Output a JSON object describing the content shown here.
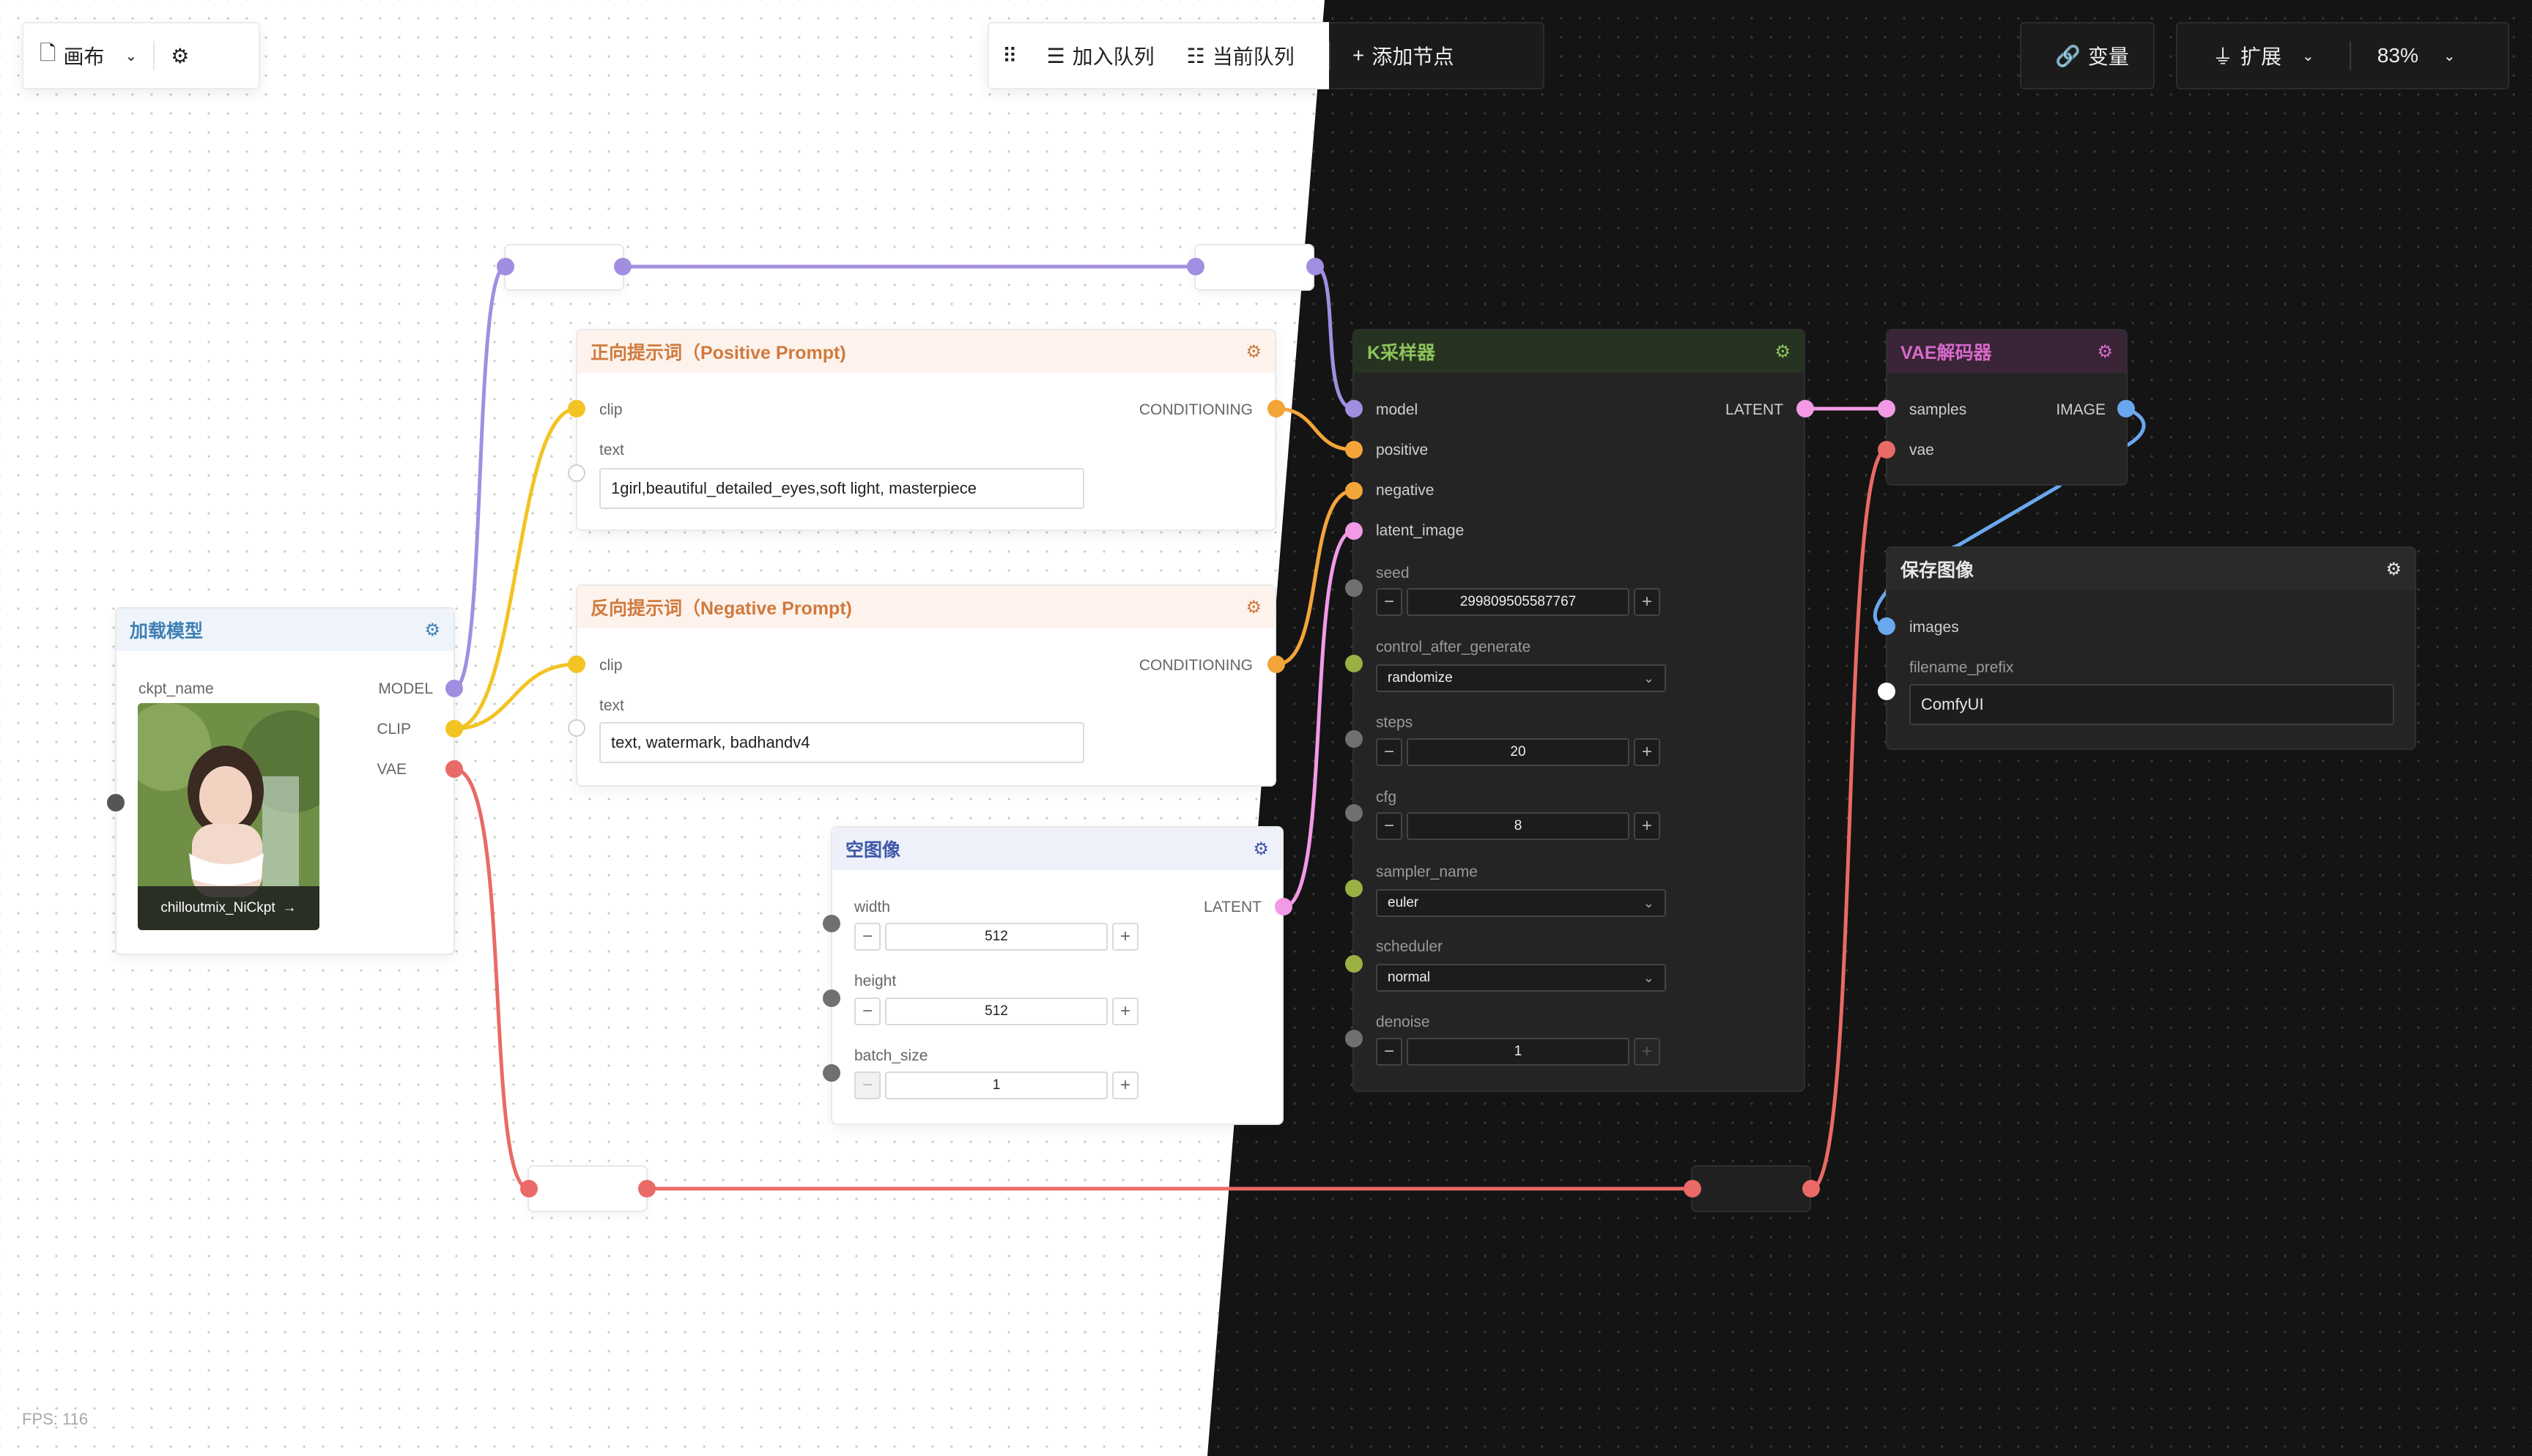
{
  "toolbar": {
    "canvas_label": "画布",
    "queue_label": "加入队列",
    "current_queue_label": "当前队列",
    "add_node_label": "添加节点",
    "variables_label": "变量",
    "extensions_label": "扩展",
    "zoom": "83%"
  },
  "nodes": {
    "load_model": {
      "title": "加载模型",
      "ckpt_label": "ckpt_name",
      "out_model": "MODEL",
      "out_clip": "CLIP",
      "out_vae": "VAE",
      "ckpt_value": "chilloutmix_NiCkpt"
    },
    "positive": {
      "title": "正向提示词（Positive Prompt)",
      "in_clip": "clip",
      "text_label": "text",
      "out": "CONDITIONING",
      "text": "1girl,beautiful_detailed_eyes,soft light, masterpiece"
    },
    "negative": {
      "title": "反向提示词（Negative Prompt)",
      "in_clip": "clip",
      "text_label": "text",
      "out": "CONDITIONING",
      "text": "text, watermark, badhandv4"
    },
    "empty_latent": {
      "title": "空图像",
      "width_label": "width",
      "width": "512",
      "height_label": "height",
      "height": "512",
      "batch_label": "batch_size",
      "batch": "1",
      "out": "LATENT"
    },
    "ksampler": {
      "title": "K采样器",
      "in_model": "model",
      "in_positive": "positive",
      "in_negative": "negative",
      "in_latent": "latent_image",
      "out": "LATENT",
      "seed_label": "seed",
      "seed": "299809505587767",
      "control_label": "control_after_generate",
      "control": "randomize",
      "steps_label": "steps",
      "steps": "20",
      "cfg_label": "cfg",
      "cfg": "8",
      "sampler_label": "sampler_name",
      "sampler": "euler",
      "scheduler_label": "scheduler",
      "scheduler": "normal",
      "denoise_label": "denoise",
      "denoise": "1"
    },
    "vae_decode": {
      "title": "VAE解码器",
      "in_samples": "samples",
      "in_vae": "vae",
      "out": "IMAGE"
    },
    "save_image": {
      "title": "保存图像",
      "in_images": "images",
      "prefix_label": "filename_prefix",
      "prefix": "ComfyUI"
    }
  },
  "fps": "FPS:  116",
  "colors": {
    "model": "#a28ee0",
    "clip": "#f3c324",
    "conditioning": "#f4a53a",
    "latent": "#f29ae6",
    "vae": "#e96a66",
    "image": "#69a8ee",
    "int": "#707070",
    "combo": "#9bb043"
  },
  "icons": {
    "canvas": "file-icon",
    "settings": "gear-icon",
    "drag": "drag-handle-icon",
    "queue": "list-icon",
    "current_queue": "queue-list-icon",
    "add": "plus-icon",
    "variables": "link-icon",
    "extensions": "plug-icon",
    "chevron": "chevron-down-icon"
  }
}
